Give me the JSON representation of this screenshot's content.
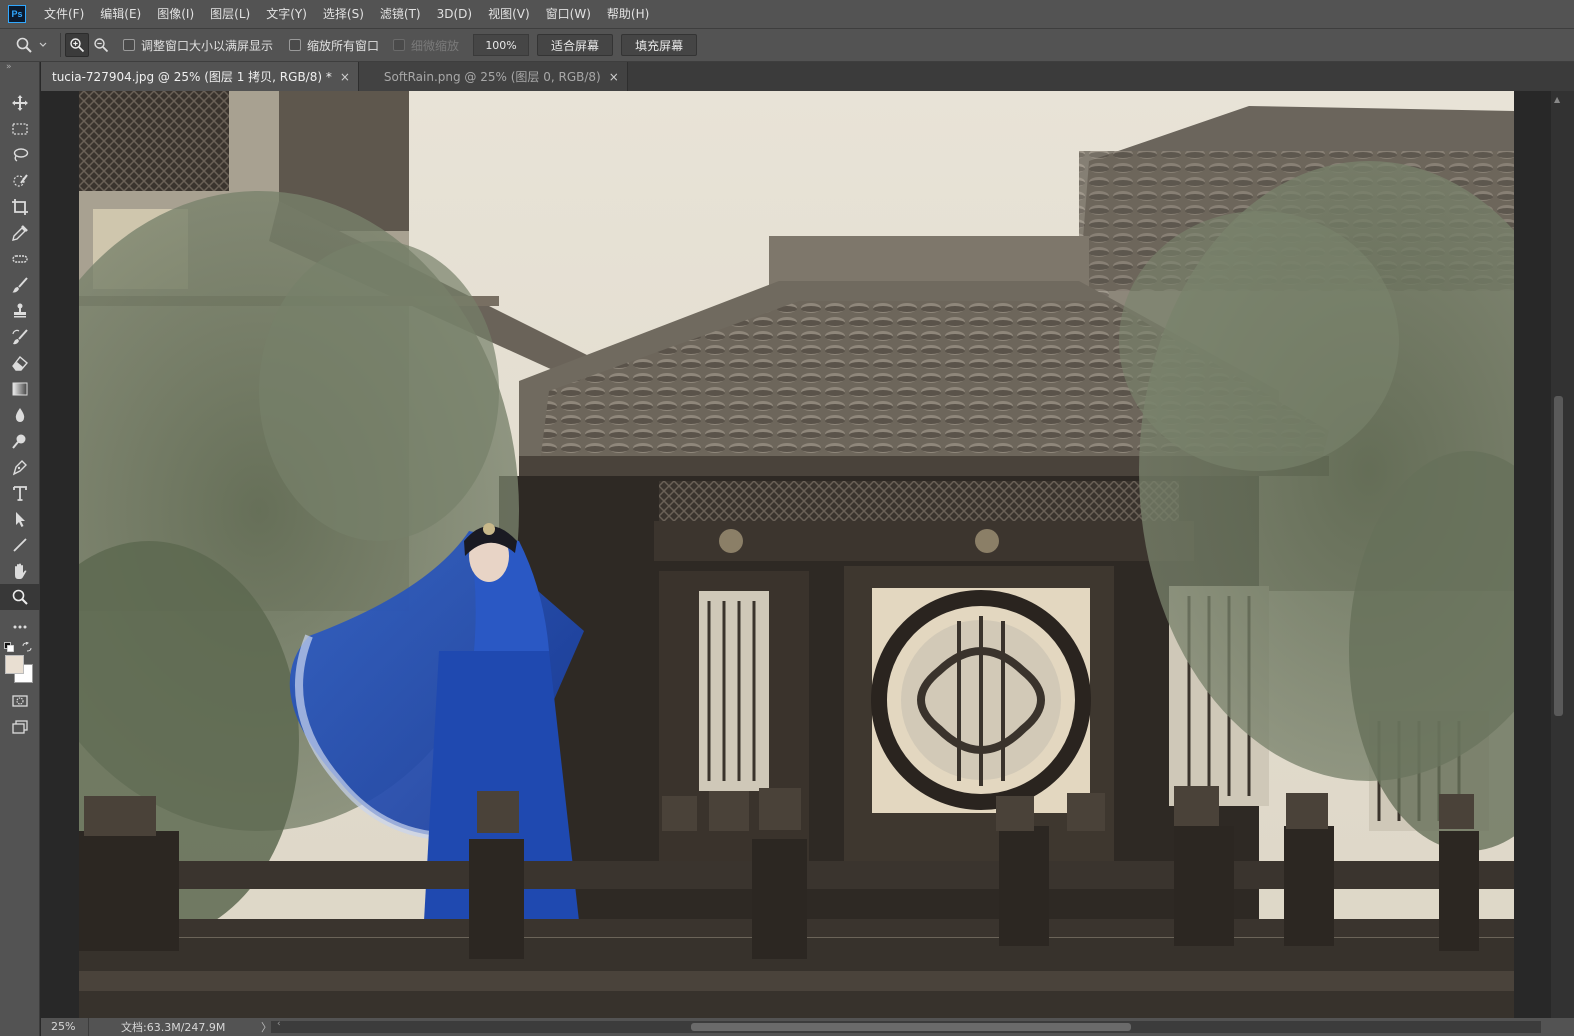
{
  "app": {
    "logo_text": "Ps"
  },
  "menu": [
    "文件(F)",
    "编辑(E)",
    "图像(I)",
    "图层(L)",
    "文字(Y)",
    "选择(S)",
    "滤镜(T)",
    "3D(D)",
    "视图(V)",
    "窗口(W)",
    "帮助(H)"
  ],
  "options": {
    "resize_windows_label": "调整窗口大小以满屏显示",
    "zoom_all_windows_label": "缩放所有窗口",
    "scrubby_zoom_label": "细微缩放",
    "zoom_value": "100%",
    "fit_screen_label": "适合屏幕",
    "fill_screen_label": "填充屏幕"
  },
  "tabs": [
    {
      "label": "tucia-727904.jpg @ 25% (图层 1 拷贝, RGB/8) *",
      "active": true
    },
    {
      "label": "SoftRain.png @ 25% (图层 0, RGB/8)",
      "active": false
    }
  ],
  "tab_close_glyph": "×",
  "status": {
    "zoom": "25%",
    "doc_info": "文档:63.3M/247.9M",
    "arrow": "〉"
  },
  "colors": {
    "foreground": "#e9dfd2",
    "background": "#ffffff",
    "canvas_bg": "#282828",
    "ui_panel": "#535353"
  }
}
